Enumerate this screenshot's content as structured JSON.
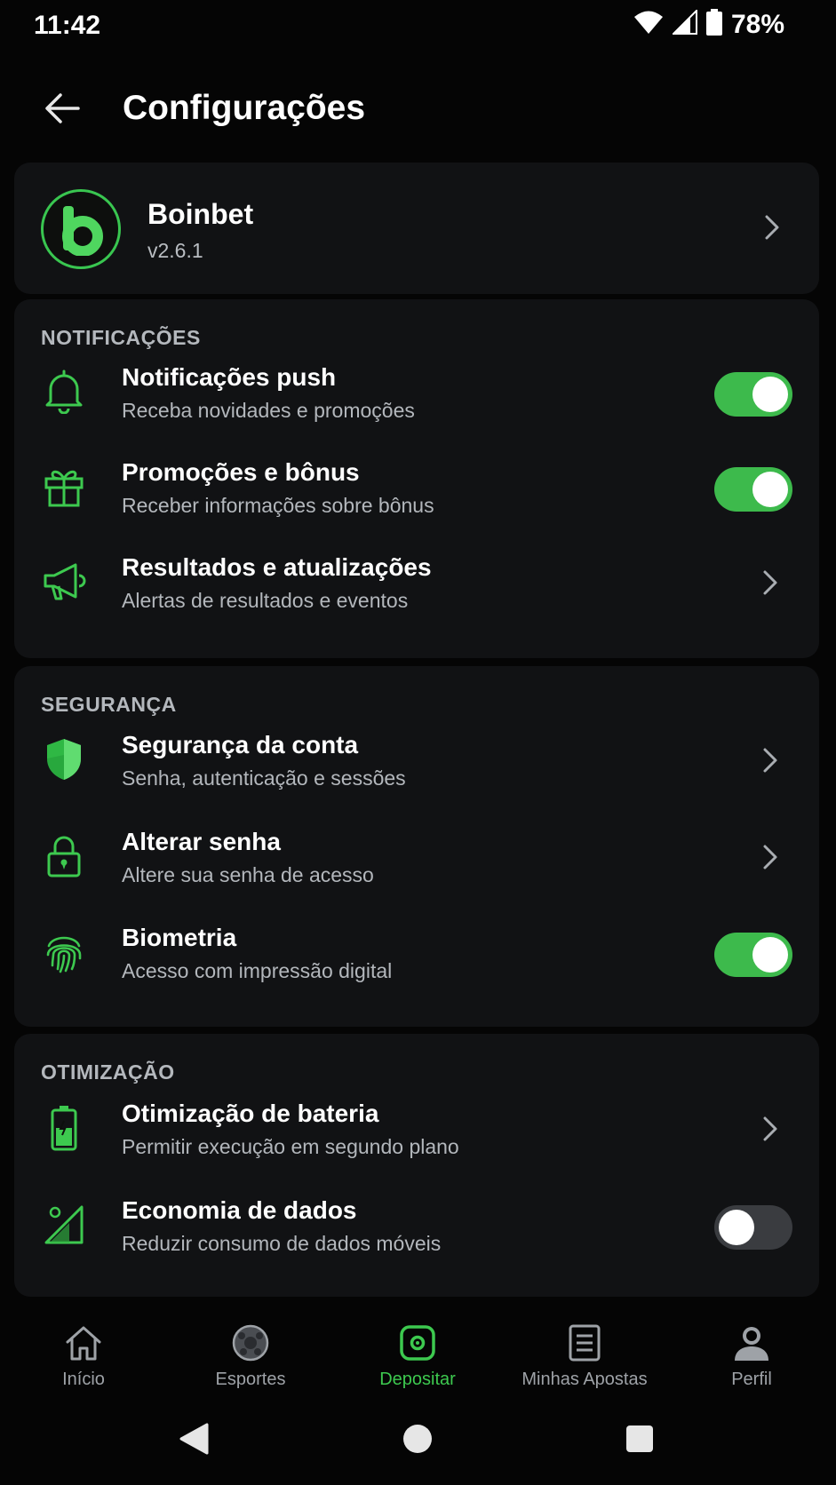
{
  "status_bar": {
    "time": "11:42",
    "battery": "78%"
  },
  "header": {
    "title": "Configurações"
  },
  "app_info": {
    "name": "Boinbet",
    "version": "v2.6.1",
    "logo_icon": "boinbet-logo-icon"
  },
  "sections": {
    "notificacoes": {
      "title": "NOTIFICAÇÕES",
      "items": [
        {
          "title": "Notificações push",
          "subtitle": "Receba novidades e promoções",
          "icon": "bell-icon",
          "control": "toggle",
          "enabled": true
        },
        {
          "title": "Promoções e bônus",
          "subtitle": "Receber informações sobre bônus",
          "icon": "gift-icon",
          "control": "toggle",
          "enabled": true
        },
        {
          "title": "Resultados e atualizações",
          "subtitle": "Alertas de resultados e eventos",
          "icon": "megaphone-icon",
          "control": "chevron"
        }
      ]
    },
    "seguranca": {
      "title": "SEGURANÇA",
      "items": [
        {
          "title": "Segurança da conta",
          "subtitle": "Senha, autenticação e sessões",
          "icon": "shield-icon",
          "control": "chevron"
        },
        {
          "title": "Alterar senha",
          "subtitle": "Altere sua senha de acesso",
          "icon": "lock-icon",
          "control": "chevron"
        },
        {
          "title": "Biometria",
          "subtitle": "Acesso com impressão digital",
          "icon": "fingerprint-icon",
          "control": "toggle",
          "enabled": true
        }
      ]
    },
    "otimizacao": {
      "title": "OTIMIZAÇÃO",
      "items": [
        {
          "title": "Otimização de bateria",
          "subtitle": "Permitir execução em segundo plano",
          "icon": "battery-icon",
          "control": "chevron"
        },
        {
          "title": "Economia de dados",
          "subtitle": "Reduzir consumo de dados móveis",
          "icon": "data-saver-icon",
          "control": "toggle",
          "enabled": false
        }
      ]
    }
  },
  "bottom_nav": [
    {
      "label": "Início",
      "icon": "home-icon",
      "active": false
    },
    {
      "label": "Esportes",
      "icon": "sports-ball-icon",
      "active": false
    },
    {
      "label": "Depositar",
      "icon": "deposit-icon",
      "active": true
    },
    {
      "label": "Minhas Apostas",
      "icon": "bets-list-icon",
      "active": false
    },
    {
      "label": "Perfil",
      "icon": "profile-icon",
      "active": false
    }
  ],
  "colors": {
    "accent": "#3dba4c",
    "background": "#050505",
    "card": "#111214",
    "muted_text": "#b3b7bc"
  }
}
